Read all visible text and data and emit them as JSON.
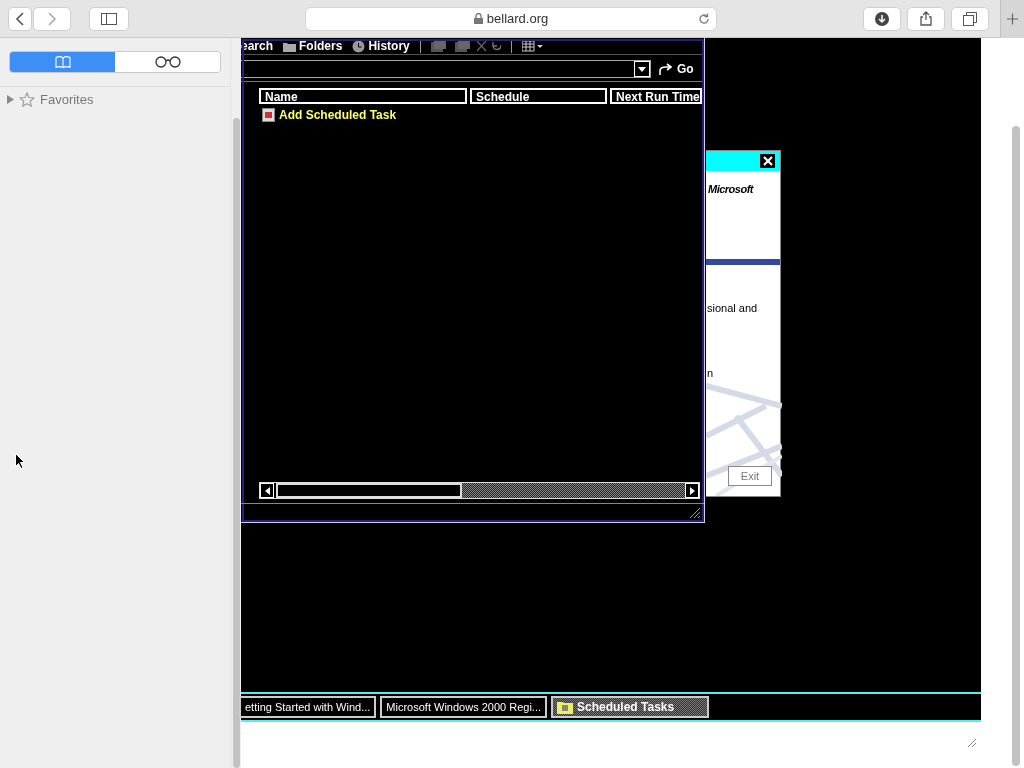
{
  "browser": {
    "url": "bellard.org"
  },
  "sidebar": {
    "tabs": [
      {
        "kind": "bookmarks",
        "selected": true
      },
      {
        "kind": "reading-list",
        "selected": false
      }
    ],
    "favorites": {
      "label": "Favorites",
      "expanded": false
    }
  },
  "explorer": {
    "toolbar": [
      "earch",
      "Folders",
      "History"
    ],
    "go": "Go",
    "columns": [
      "Name",
      "Schedule",
      "Next Run Time"
    ],
    "items": [
      "Add Scheduled Task"
    ]
  },
  "dialog": {
    "logo": "Microsoft",
    "texts": [
      "sional and",
      "n"
    ],
    "exit": "Exit"
  },
  "taskbar": [
    {
      "label": "etting Started with Wind...",
      "selected": false
    },
    {
      "label": "Microsoft Windows 2000 Regi...",
      "selected": false
    },
    {
      "label": "Scheduled Tasks",
      "selected": true
    }
  ]
}
